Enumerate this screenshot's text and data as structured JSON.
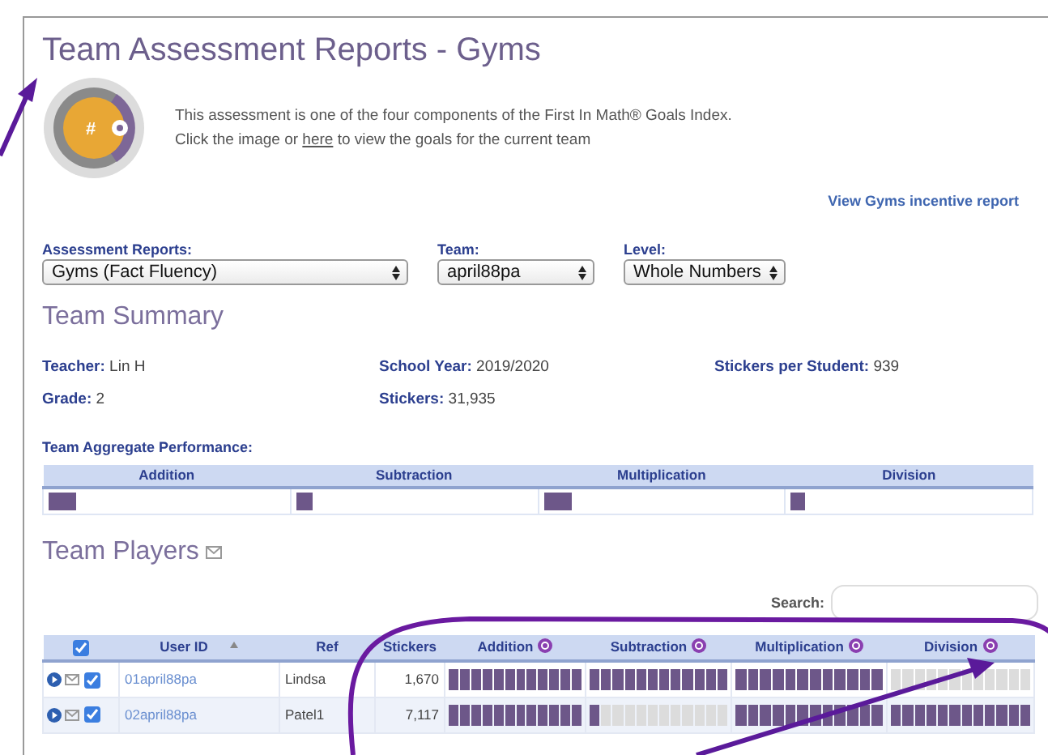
{
  "title": "Team Assessment Reports - Gyms",
  "logo": {
    "label": "#"
  },
  "intro": {
    "line1": "This assessment is one of the four components of the First In Math® Goals Index.",
    "line2_before": "Click the image or ",
    "line2_link": "here",
    "line2_after": " to view the goals for the current team"
  },
  "incentive_link": "View Gyms incentive report",
  "filters": [
    {
      "label": "Assessment Reports:",
      "value": "Gyms (Fact Fluency)"
    },
    {
      "label": "Team:",
      "value": "april88pa"
    },
    {
      "label": "Level:",
      "value": "Whole Numbers"
    }
  ],
  "summary": {
    "heading": "Team Summary",
    "facts": [
      {
        "label": "Teacher:",
        "value": "Lin H"
      },
      {
        "label": "School Year:",
        "value": "2019/2020"
      },
      {
        "label": "Stickers per Student:",
        "value": "939"
      },
      {
        "label": "Grade:",
        "value": "2"
      },
      {
        "label": "Stickers:",
        "value": "31,935"
      }
    ]
  },
  "aggregate": {
    "label": "Team Aggregate Performance:",
    "columns": [
      {
        "name": "Addition",
        "level": 0.12
      },
      {
        "name": "Subtraction",
        "level": 0.07
      },
      {
        "name": "Multiplication",
        "level": 0.12
      },
      {
        "name": "Division",
        "level": 0.06
      }
    ]
  },
  "players": {
    "heading": "Team Players",
    "search_label": "Search:",
    "all_checked": true,
    "columns": [
      "User ID",
      "Ref",
      "Stickers",
      "Addition",
      "Subtraction",
      "Multiplication",
      "Division"
    ],
    "rows": [
      {
        "user_id": "01april88pa",
        "ref": "Lindsa",
        "stickers": "1,670",
        "checked": true,
        "levels": [
          {
            "level": 1
          },
          {
            "level": 1
          },
          {
            "level": 1
          },
          {
            "empty": true
          }
        ]
      },
      {
        "user_id": "02april88pa",
        "ref": "Patel1",
        "stickers": "7,117",
        "checked": true,
        "levels": [
          {
            "level": 1
          },
          {
            "level": 0.0833
          },
          {
            "level": 1
          },
          {
            "level": 1
          }
        ]
      }
    ]
  }
}
